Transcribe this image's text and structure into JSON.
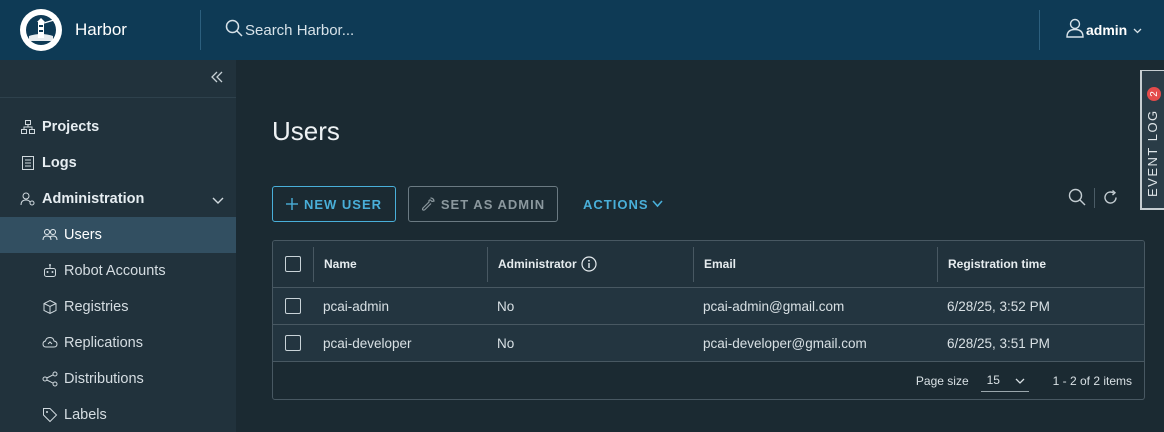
{
  "header": {
    "brand": "Harbor",
    "search_placeholder": "Search Harbor...",
    "user": "admin"
  },
  "sidebar": {
    "items": [
      {
        "label": "Projects",
        "icon": "projects-icon"
      },
      {
        "label": "Logs",
        "icon": "logs-icon"
      },
      {
        "label": "Administration",
        "icon": "administration-icon",
        "expanded": true
      },
      {
        "label": "Users",
        "icon": "users-icon",
        "active": true
      },
      {
        "label": "Robot Accounts",
        "icon": "robot-icon"
      },
      {
        "label": "Registries",
        "icon": "registries-icon"
      },
      {
        "label": "Replications",
        "icon": "replications-icon"
      },
      {
        "label": "Distributions",
        "icon": "distributions-icon"
      },
      {
        "label": "Labels",
        "icon": "labels-icon"
      }
    ]
  },
  "main": {
    "title": "Users",
    "new_user": "NEW USER",
    "set_admin": "SET AS ADMIN",
    "actions": "ACTIONS"
  },
  "table": {
    "columns": [
      "Name",
      "Administrator",
      "Email",
      "Registration time"
    ],
    "rows": [
      {
        "name": "pcai-admin",
        "admin": "No",
        "email": "pcai-admin@gmail.com",
        "time": "6/28/25, 3:52 PM"
      },
      {
        "name": "pcai-developer",
        "admin": "No",
        "email": "pcai-developer@gmail.com",
        "time": "6/28/25, 3:51 PM"
      }
    ],
    "page_size_label": "Page size",
    "page_size": "15",
    "summary": "1 - 2 of 2 items"
  },
  "event_log": {
    "label": "EVENT LOG",
    "count": "2"
  },
  "colors": {
    "header_bg": "#0e3a55",
    "sidebar_bg": "#21323c",
    "main_bg": "#1b2a32",
    "accent": "#49afd9",
    "badge": "#e44b4b"
  }
}
